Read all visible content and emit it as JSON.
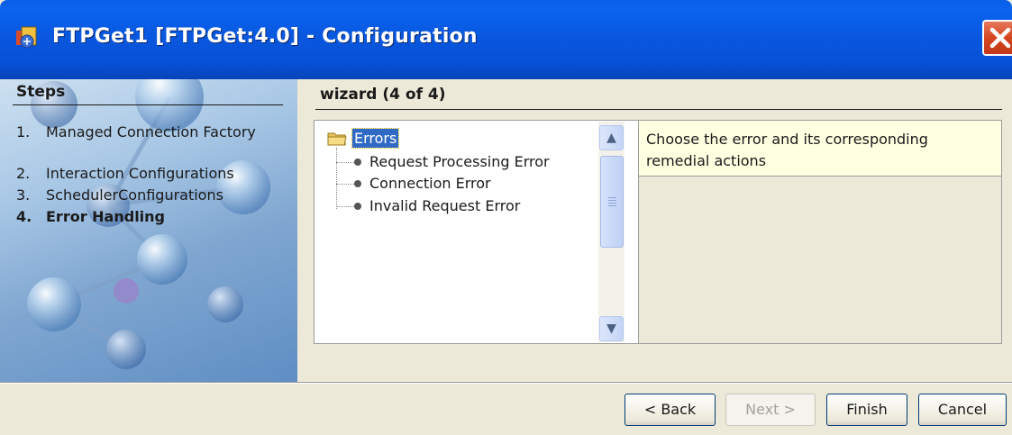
{
  "window": {
    "title": "FTPGet1 [FTPGet:4.0] - Configuration"
  },
  "steps": {
    "title": "Steps",
    "items": [
      {
        "num": "1.",
        "label": "Managed Connection Factory",
        "active": false
      },
      {
        "num": "2.",
        "label": "Interaction Configurations",
        "active": false
      },
      {
        "num": "3.",
        "label": "SchedulerConfigurations",
        "active": false
      },
      {
        "num": "4.",
        "label": "Error Handling",
        "active": true
      }
    ]
  },
  "wizard": {
    "title": "wizard (4 of 4)"
  },
  "tree": {
    "root": "Errors",
    "items": [
      "Request Processing Error",
      "Connection Error",
      "Invalid Request Error"
    ]
  },
  "description": {
    "text": "Choose the error and its corresponding remedial actions"
  },
  "buttons": {
    "back": "< Back",
    "next": "Next >",
    "finish": "Finish",
    "cancel": "Cancel"
  },
  "icons": {
    "app": "app-icon",
    "close": "close-icon",
    "folder": "folder-icon",
    "scroll_up": "scroll-up-icon",
    "scroll_down": "scroll-down-icon"
  }
}
